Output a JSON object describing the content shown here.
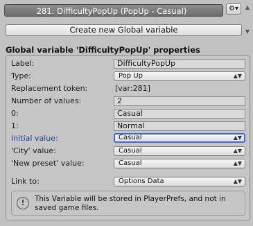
{
  "header": {
    "title": "281: DifficultyPopUp (PopUp - Casual)",
    "gear_icon": "gear-icon",
    "scroll_up_icon": "up-arrow-icon",
    "scroll_down_icon": "down-arrow-icon"
  },
  "create_button": {
    "label": "Create new Global variable"
  },
  "section": {
    "title": "Global variable 'DifficultyPopUp' properties"
  },
  "properties": {
    "label": {
      "name": "Label:",
      "value": "DifficultyPopUp"
    },
    "type": {
      "name": "Type:",
      "value": "Pop Up"
    },
    "token": {
      "name": "Replacement token:",
      "value": "[var:281]"
    },
    "num_values": {
      "name": "Number of values:",
      "value": "2"
    },
    "value0": {
      "name": "0:",
      "value": "Casual"
    },
    "value1": {
      "name": "1:",
      "value": "Normal"
    },
    "initial": {
      "name": "Initial value:",
      "value": "Casual"
    },
    "city": {
      "name": "'City' value:",
      "value": "Casual"
    },
    "new_preset": {
      "name": "'New preset' value:",
      "value": "Casual"
    },
    "link_to": {
      "name": "Link to:",
      "value": "Options Data"
    }
  },
  "help": {
    "icon": "info-icon",
    "text": "This Variable will be stored in PlayerPrefs, and not in saved game files."
  },
  "colors": {
    "focus_blue": "#3d6ad6",
    "label_blue": "#1e3fa6"
  }
}
